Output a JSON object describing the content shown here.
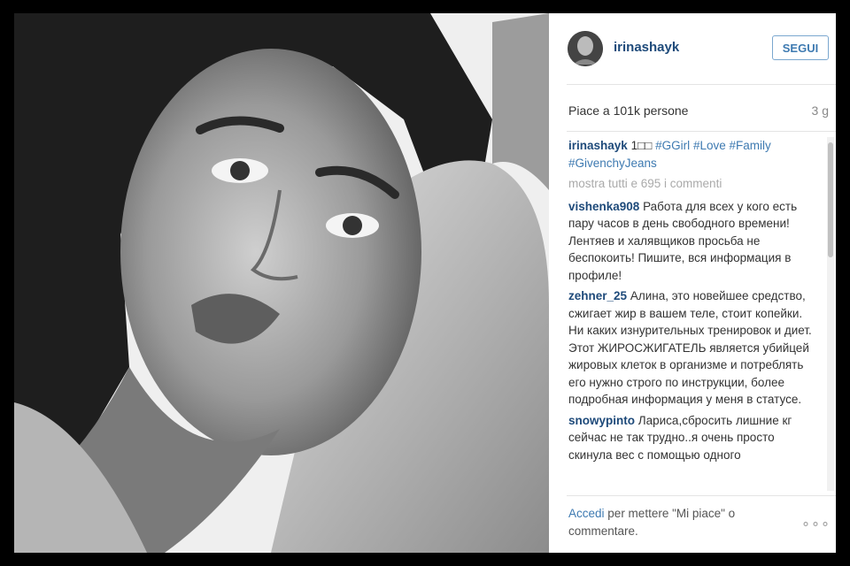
{
  "post": {
    "username": "irinashayk",
    "follow_label": "SEGUI",
    "likes": "Piace a 101k persone",
    "time": "3 g",
    "caption": {
      "user": "irinashayk",
      "prefix": "1□□",
      "tags": [
        "#GGirl",
        "#Love",
        "#Family",
        "#GivenchyJeans"
      ]
    },
    "more_comments": "mostra tutti e 695 i commenti",
    "comments": [
      {
        "user": "vishenka908",
        "text": "Работа для всех у кого есть пару часов в день свободного времени! Лентяев и халявщиков просьба не беспокоить! Пишите, вся информация в профиле!"
      },
      {
        "user": "zehner_25",
        "text": "Алина, это новейшее средство, сжигает жир в вашем теле, стоит копейки. Ни каких изнурительных тренировок и диет. Этот ЖИРОСЖИГАТЕЛЬ является убийцей жировых клеток в организме и потреблять его нужно строго по инструкции, более подробная информация у меня в статусе."
      },
      {
        "user": "snowypinto",
        "text": "Лариса,сбросить лишние кг сейчас не так трудно..я очень просто скинула вес с помощью одного"
      }
    ],
    "footer": {
      "login_label": "Accedi",
      "rest": "per mettere \"Mi piace\" o commentare."
    },
    "options_label": "∘∘∘"
  }
}
